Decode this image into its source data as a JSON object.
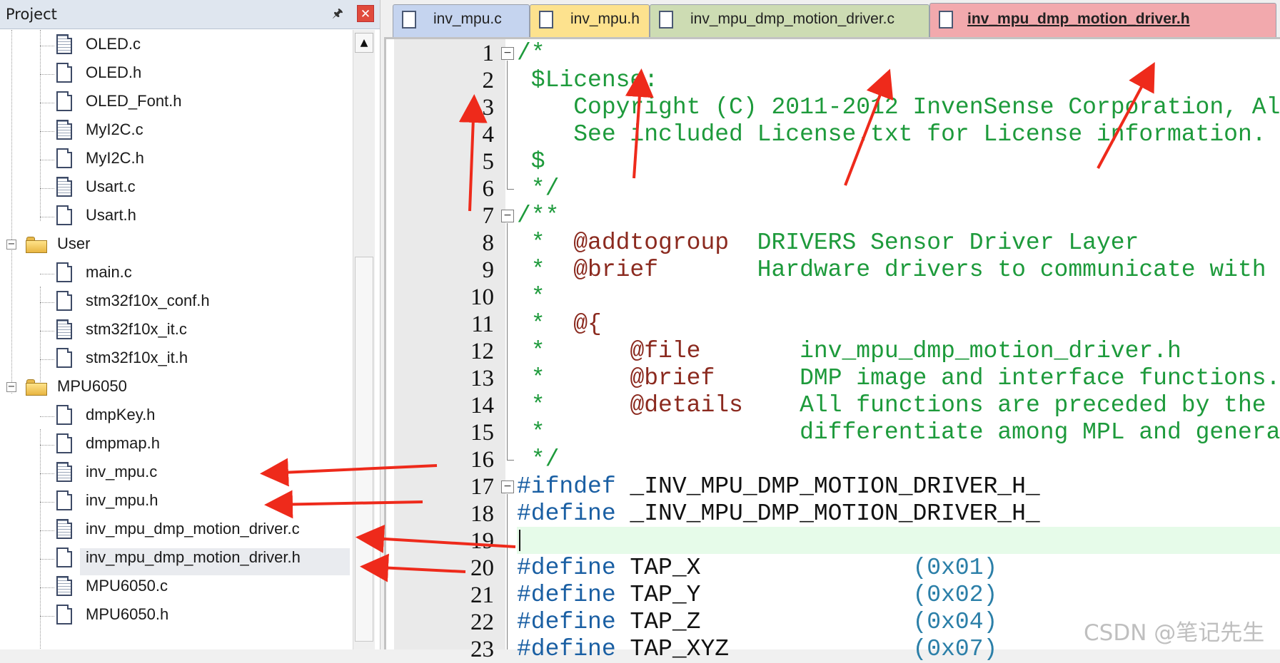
{
  "project": {
    "title": "Project",
    "pin_icon": "pin-icon",
    "close_icon": "close-icon",
    "tree": [
      {
        "label": "OLED.c",
        "type": "c-file"
      },
      {
        "label": "OLED.h",
        "type": "h-file"
      },
      {
        "label": "OLED_Font.h",
        "type": "h-file"
      },
      {
        "label": "MyI2C.c",
        "type": "c-file"
      },
      {
        "label": "MyI2C.h",
        "type": "h-file"
      },
      {
        "label": "Usart.c",
        "type": "c-file"
      },
      {
        "label": "Usart.h",
        "type": "h-file"
      },
      {
        "label": "User",
        "type": "folder",
        "expanded": true
      },
      {
        "label": "main.c",
        "type": "c-file"
      },
      {
        "label": "stm32f10x_conf.h",
        "type": "h-file"
      },
      {
        "label": "stm32f10x_it.c",
        "type": "c-file"
      },
      {
        "label": "stm32f10x_it.h",
        "type": "h-file"
      },
      {
        "label": "MPU6050",
        "type": "folder",
        "expanded": true
      },
      {
        "label": "dmpKey.h",
        "type": "h-file"
      },
      {
        "label": "dmpmap.h",
        "type": "h-file"
      },
      {
        "label": "inv_mpu.c",
        "type": "c-file"
      },
      {
        "label": "inv_mpu.h",
        "type": "h-file"
      },
      {
        "label": "inv_mpu_dmp_motion_driver.c",
        "type": "c-file"
      },
      {
        "label": "inv_mpu_dmp_motion_driver.h",
        "type": "h-file",
        "selected": true
      },
      {
        "label": "MPU6050.c",
        "type": "c-file"
      },
      {
        "label": "MPU6050.h",
        "type": "h-file"
      }
    ]
  },
  "tabs": [
    {
      "label": "inv_mpu.c",
      "color": "#c5d4ef"
    },
    {
      "label": "inv_mpu.h",
      "color": "#fde28e"
    },
    {
      "label": "inv_mpu_dmp_motion_driver.c",
      "color": "#cddcb3"
    },
    {
      "label": "inv_mpu_dmp_motion_driver.h",
      "color": "#f2a9ad",
      "active": true
    }
  ],
  "editor": {
    "line_numbers": [
      "1",
      "2",
      "3",
      "4",
      "5",
      "6",
      "7",
      "8",
      "9",
      "10",
      "11",
      "12",
      "13",
      "14",
      "15",
      "16",
      "17",
      "18",
      "19",
      "20",
      "21",
      "22",
      "23"
    ],
    "lines": {
      "l1": "/*",
      "l2": " $License:",
      "l3": "    Copyright (C) 2011-2012 InvenSense Corporation, Al",
      "l4": "    See included License.txt for License information.",
      "l5": " $",
      "l6": " */",
      "l7": "/**",
      "l8a": " *  ",
      "l8b": "@addtogroup",
      "l8c": "  DRIVERS Sensor Driver Layer",
      "l9a": " *  ",
      "l9b": "@brief",
      "l9c": "       Hardware drivers to communicate with",
      "l10": " *",
      "l11a": " *  ",
      "l11b": "@{",
      "l12a": " *      ",
      "l12b": "@file",
      "l12c": "       inv_mpu_dmp_motion_driver.h",
      "l13a": " *      ",
      "l13b": "@brief",
      "l13c": "      DMP image and interface functions.",
      "l14a": " *      ",
      "l14b": "@details",
      "l14c": "    All functions are preceded by the",
      "l15a": " *                  ",
      "l15b": "differentiate among MPL and genera",
      "l16": " */",
      "l17a": "#ifndef",
      "l17b": " _INV_MPU_DMP_MOTION_DRIVER_H_",
      "l18a": "#define",
      "l18b": " _INV_MPU_DMP_MOTION_DRIVER_H_",
      "l19": "",
      "l20a": "#define",
      "l20b": " TAP_X               ",
      "l20c": "(0x01)",
      "l21a": "#define",
      "l21b": " TAP_Y               ",
      "l21c": "(0x02)",
      "l22a": "#define",
      "l22b": " TAP_Z               ",
      "l22c": "(0x04)",
      "l23a": "#define",
      "l23b": " TAP_XYZ             ",
      "l23c": "(0x07)"
    }
  },
  "watermark": "CSDN @笔记先生",
  "colors": {
    "comment": "#1d9a3b",
    "doc_tag": "#8b2a1f",
    "preprocessor": "#1a5fa3",
    "number": "#2b7fa8",
    "arrow": "#ee2a1b"
  }
}
